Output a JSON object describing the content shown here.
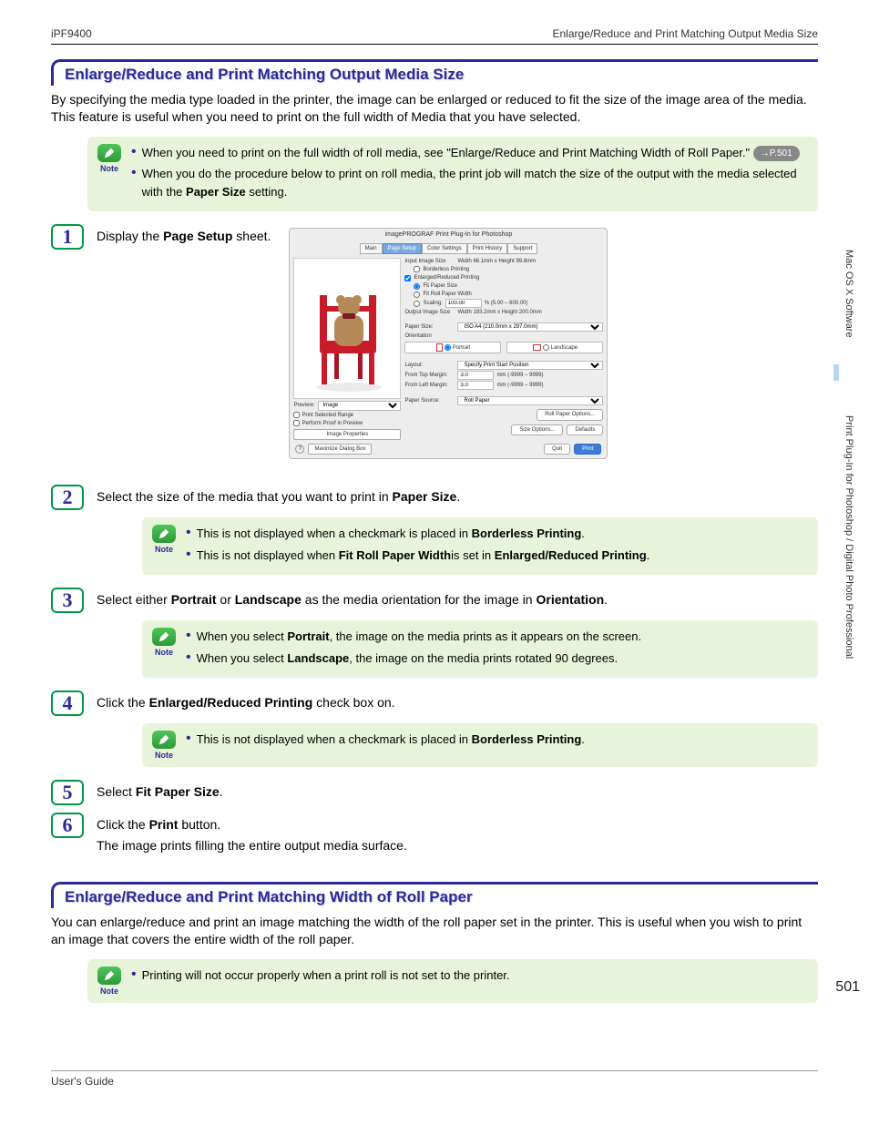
{
  "header": {
    "left": "iPF9400",
    "right": "Enlarge/Reduce and Print Matching Output Media Size"
  },
  "sidebar": {
    "tab1": "Mac OS X Software",
    "tab2": "Print Plug-In for Photoshop / Digital Photo Professional"
  },
  "pageNumber": "501",
  "footer": "User's Guide",
  "section1": {
    "title": "Enlarge/Reduce and Print Matching Output Media Size",
    "intro": "By specifying the media type loaded in the printer, the image can be enlarged or reduced to fit the size of the image area of the media. This feature is useful when you need to print on the full width of Media that you have selected."
  },
  "note1": {
    "b1a": "When you need to print on the full width of roll media, see \"Enlarge/Reduce and Print Matching Width of Roll Paper.\"",
    "ref": "→P.501",
    "b2a": "When you do the procedure below to print on roll media, the print job will match the size of the output with the media selected with the ",
    "b2b": "Paper Size",
    "b2c": " setting."
  },
  "steps": {
    "s1a": "Display the ",
    "s1b": "Page Setup",
    "s1c": " sheet.",
    "s2a": "Select the size of the media that you want to print in ",
    "s2b": "Paper Size",
    "s2c": ".",
    "s3a": "Select either ",
    "s3b": "Portrait",
    "s3c": " or ",
    "s3d": "Landscape",
    "s3e": " as the media orientation for the image in ",
    "s3f": "Orientation",
    "s3g": ".",
    "s4a": "Click the ",
    "s4b": "Enlarged/Reduced Printing",
    "s4c": " check box on.",
    "s5a": "Select ",
    "s5b": "Fit Paper Size",
    "s5c": ".",
    "s6a": "Click the ",
    "s6b": "Print",
    "s6c": " button.",
    "s6d": "The image prints filling the entire output media surface."
  },
  "note2": {
    "b1a": "This is not displayed when a checkmark is placed in ",
    "b1b": "Borderless Printing",
    "b1c": ".",
    "b2a": "This is not displayed when ",
    "b2b": "Fit Roll Paper Width",
    "b2c": "is set in ",
    "b2d": "Enlarged/Reduced Printing",
    "b2e": "."
  },
  "note3": {
    "b1a": "When you select ",
    "b1b": "Portrait",
    "b1c": ", the image on the media prints as it appears on the screen.",
    "b2a": "When you select ",
    "b2b": "Landscape",
    "b2c": ", the image on the media prints rotated 90 degrees."
  },
  "note4": {
    "b1a": "This is not displayed when a checkmark is placed in ",
    "b1b": "Borderless Printing",
    "b1c": "."
  },
  "section2": {
    "title": "Enlarge/Reduce and Print Matching Width of Roll Paper",
    "intro": "You can enlarge/reduce and print an image matching the width of the roll paper set in the printer. This is useful when you wish to print an image that covers the entire width of the roll paper."
  },
  "note5": {
    "b1": "Printing will not occur properly when a print roll is not set to the printer."
  },
  "noteLabel": "Note",
  "dialog": {
    "title": "imagePROGRAF Print Plug-In for Photoshop",
    "tabs": [
      "Main",
      "Page Setup",
      "Color Settings",
      "Print History",
      "Support"
    ],
    "previewLabel": "Preview:",
    "previewValue": "Image",
    "printSelectedRange": "Print Selected Range",
    "performProof": "Perform Proof in Preview",
    "imageProperties": "Image Properties",
    "maximize": "Maximize Dialog Box",
    "inputImageSizeLabel": "Input Image Size",
    "inputImageSizeValue": "Width 66.1mm x Height 99.8mm",
    "borderless": "Borderless Printing",
    "enlargedReduced": "Enlarged/Reduced Printing",
    "fitPaperSize": "Fit Paper Size",
    "fitRollWidth": "Fit Roll Paper Width",
    "scalingLabel": "Scaling:",
    "scalingValue": "100.00",
    "scalingRange": "% (5.00 – 600.00)",
    "outputImageSizeLabel": "Output Image Size",
    "outputImageSizeValue": "Width 193.2mm x Height 200.0mm",
    "paperSizeLabel": "Paper Size:",
    "paperSizeValue": "ISO A4 (210.0mm x 297.0mm)",
    "orientationLabel": "Orientation",
    "portrait": "Portrait",
    "landscape": "Landscape",
    "layoutLabel": "Layout:",
    "layoutValue": "Specify Print Start Position",
    "fromTopLabel": "From Top Margin:",
    "fromLeftLabel": "From Left Margin:",
    "marginValue": "3.0",
    "marginRange": "mm (-9999 – 9999)",
    "paperSourceLabel": "Paper Source:",
    "paperSourceValue": "Roll Paper",
    "rollPaperOptions": "Roll Paper Options...",
    "sizeOptions": "Size Options...",
    "defaults": "Defaults",
    "quit": "Quit",
    "print": "Print"
  }
}
